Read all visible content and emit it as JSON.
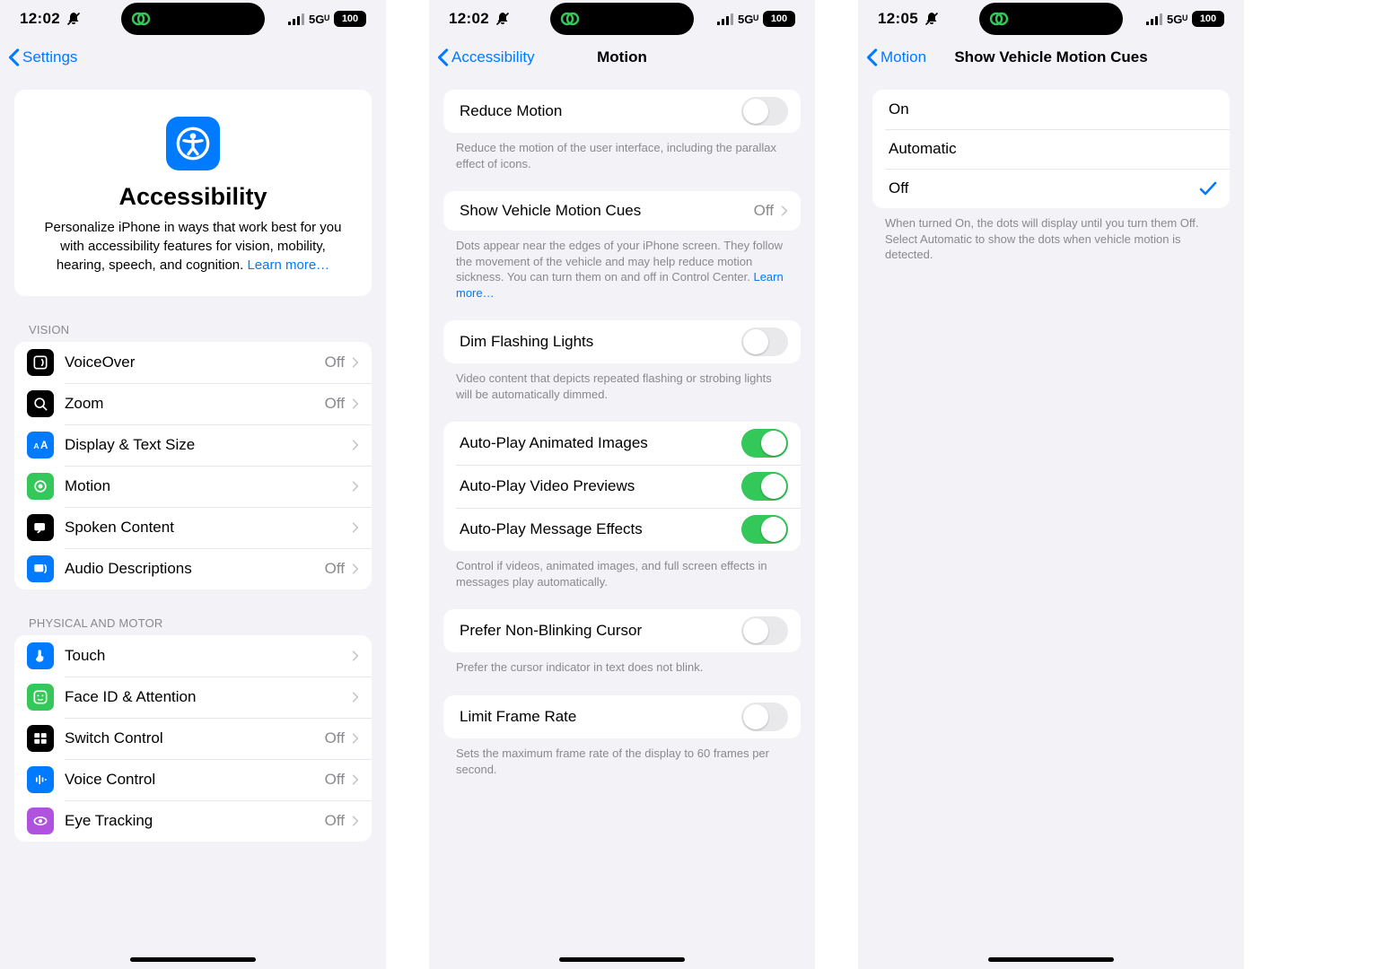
{
  "statusbar": {
    "time_a": "12:02",
    "time_b": "12:02",
    "time_c": "12:05",
    "net": "5Gᵁ",
    "battery": "100"
  },
  "p1": {
    "back": "Settings",
    "intro_title": "Accessibility",
    "intro_body": "Personalize iPhone in ways that work best for you with accessibility features for vision, mobility, hearing, speech, and cognition. ",
    "intro_link": "Learn more…",
    "section_vision": "VISION",
    "vision": {
      "voiceover": {
        "label": "VoiceOver",
        "value": "Off"
      },
      "zoom": {
        "label": "Zoom",
        "value": "Off"
      },
      "display": {
        "label": "Display & Text Size"
      },
      "motion": {
        "label": "Motion"
      },
      "spoken": {
        "label": "Spoken Content"
      },
      "audiodesc": {
        "label": "Audio Descriptions",
        "value": "Off"
      }
    },
    "section_motor": "PHYSICAL AND MOTOR",
    "motor": {
      "touch": {
        "label": "Touch"
      },
      "faceid": {
        "label": "Face ID & Attention"
      },
      "switchc": {
        "label": "Switch Control",
        "value": "Off"
      },
      "voicec": {
        "label": "Voice Control",
        "value": "Off"
      },
      "eyetrack": {
        "label": "Eye Tracking",
        "value": "Off"
      }
    }
  },
  "p2": {
    "back": "Accessibility",
    "title": "Motion",
    "reduce_motion": {
      "label": "Reduce Motion"
    },
    "reduce_motion_foot": "Reduce the motion of the user interface, including the parallax effect of icons.",
    "vehicle": {
      "label": "Show Vehicle Motion Cues",
      "value": "Off"
    },
    "vehicle_foot": "Dots appear near the edges of your iPhone screen. They follow the movement of the vehicle and may help reduce motion sickness. You can turn them on and off in Control Center. ",
    "vehicle_link": "Learn more…",
    "dim_flash": {
      "label": "Dim Flashing Lights"
    },
    "dim_flash_foot": "Video content that depicts repeated flashing or strobing lights will be automatically dimmed.",
    "autoplay_img": {
      "label": "Auto-Play Animated Images"
    },
    "autoplay_vid": {
      "label": "Auto-Play Video Previews"
    },
    "autoplay_msg": {
      "label": "Auto-Play Message Effects"
    },
    "autoplay_foot": "Control if videos, animated images, and full screen effects in messages play automatically.",
    "cursor": {
      "label": "Prefer Non-Blinking Cursor"
    },
    "cursor_foot": "Prefer the cursor indicator in text does not blink.",
    "framerate": {
      "label": "Limit Frame Rate"
    },
    "framerate_foot": "Sets the maximum frame rate of the display to 60 frames per second."
  },
  "p3": {
    "back": "Motion",
    "title": "Show Vehicle Motion Cues",
    "opt_on": "On",
    "opt_auto": "Automatic",
    "opt_off": "Off",
    "foot": "When turned On, the dots will display until you turn them Off. Select Automatic to show the dots when vehicle motion is detected."
  }
}
